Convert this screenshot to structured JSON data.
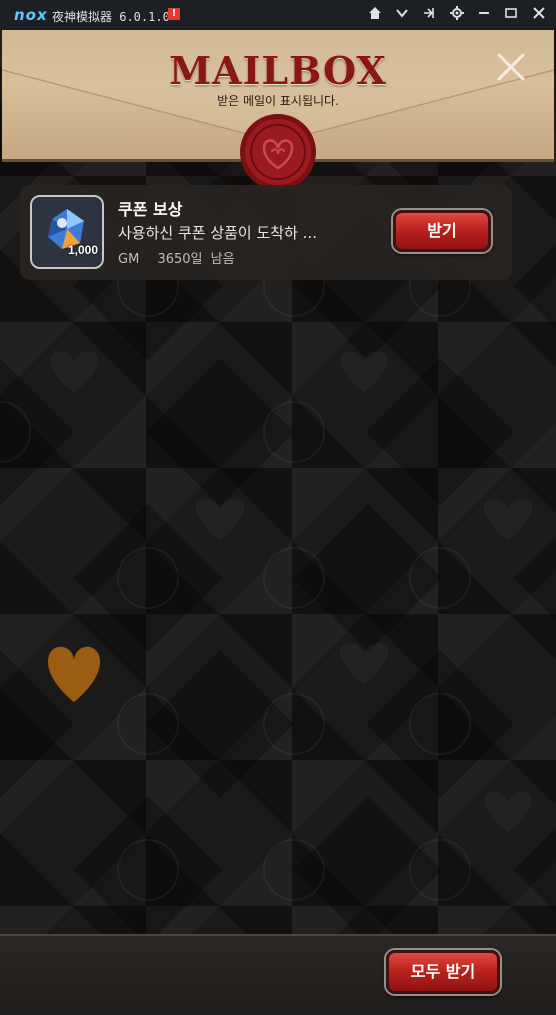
{
  "window": {
    "logo": "nox",
    "title": "夜神模拟器 6.0.1.0",
    "warning": "!",
    "controls": [
      "home-icon",
      "chevron-down-icon",
      "pin-icon",
      "gear-icon",
      "minimize-icon",
      "maximize-icon",
      "close-icon"
    ]
  },
  "header": {
    "title": "MAILBOX",
    "subtitle": "받은 메일이 표시됩니다."
  },
  "mails": [
    {
      "title": "쿠폰 보상",
      "description": "사용하신 쿠폰 상품이 도착하 ...",
      "sender": "GM",
      "remaining": "3650일 남음",
      "item_count": "1,000",
      "button_label": "받기"
    }
  ],
  "footer": {
    "claim_all_label": "모두 받기"
  },
  "colors": {
    "accent_red": "#b7201c",
    "title_red": "#8c1515",
    "parchment": "#d8bf9c",
    "titlebar": "#1c1f24"
  }
}
